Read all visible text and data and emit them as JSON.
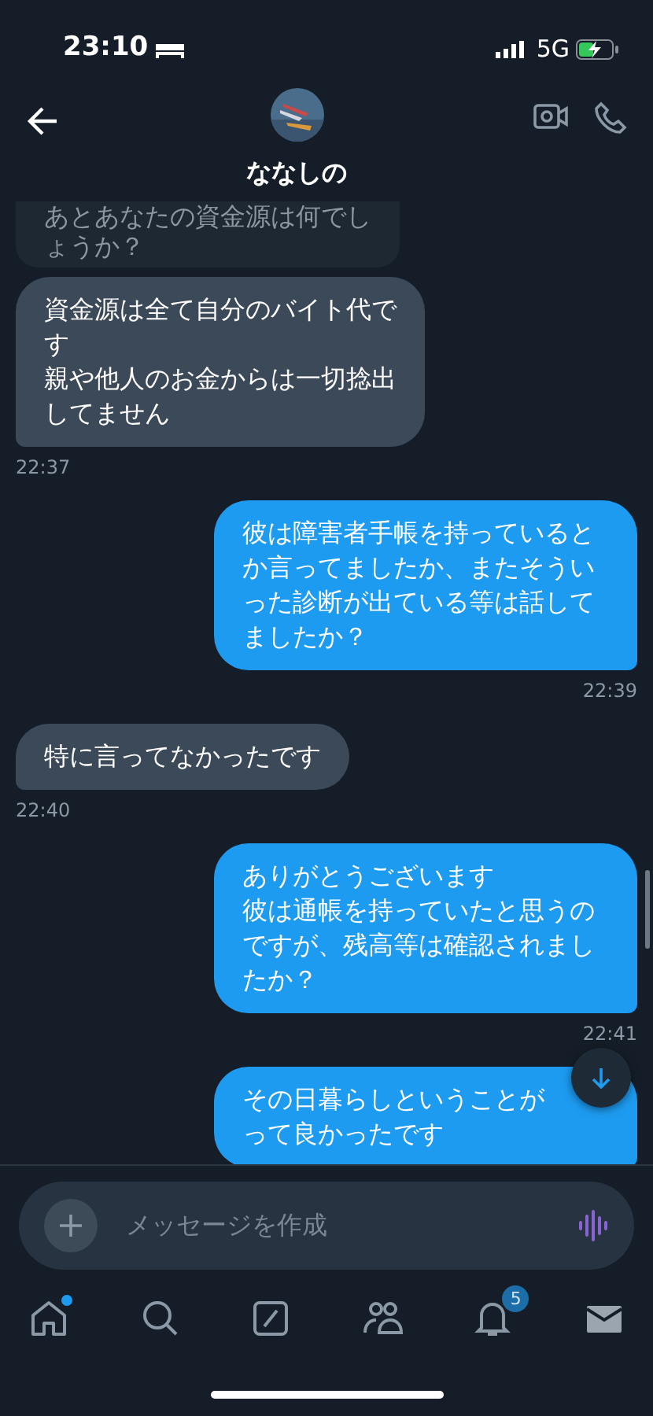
{
  "status_bar": {
    "time": "23:10",
    "network": "5G"
  },
  "header": {
    "name": "ななしの"
  },
  "messages": [
    {
      "kind": "received",
      "faded": true,
      "lines": [
        "あとあなたの資金源は何でし",
        "ょうか？"
      ]
    },
    {
      "kind": "received",
      "faded": false,
      "lines": [
        "資金源は全て自分のバイト代で",
        "す",
        "親や他人のお金からは一切捻出",
        "してません"
      ],
      "time": "22:37"
    },
    {
      "kind": "sent",
      "faded": false,
      "lines": [
        "彼は障害者手帳を持っていると",
        "か言ってましたか、またそうい",
        "った診断が出ている等は話して",
        "ましたか？"
      ],
      "time": "22:39"
    },
    {
      "kind": "received",
      "faded": false,
      "lines": [
        "特に言ってなかったです"
      ],
      "time": "22:40"
    },
    {
      "kind": "sent",
      "faded": false,
      "lines": [
        "ありがとうございます",
        "彼は通帳を持っていたと思うの",
        "ですが、残高等は確認されまし",
        "たか？"
      ],
      "time": "22:41"
    },
    {
      "kind": "sent",
      "faded": false,
      "lines": [
        "その日暮らしということが",
        "って良かったです"
      ]
    }
  ],
  "composer": {
    "placeholder": "メッセージを作成"
  },
  "tabs": [
    {
      "kind": "home",
      "selected": false,
      "dot": true
    },
    {
      "kind": "search",
      "selected": false
    },
    {
      "kind": "compose",
      "selected": false
    },
    {
      "kind": "communities",
      "selected": false
    },
    {
      "kind": "notifications",
      "selected": false,
      "badge": "5"
    },
    {
      "kind": "messages",
      "selected": true
    }
  ]
}
